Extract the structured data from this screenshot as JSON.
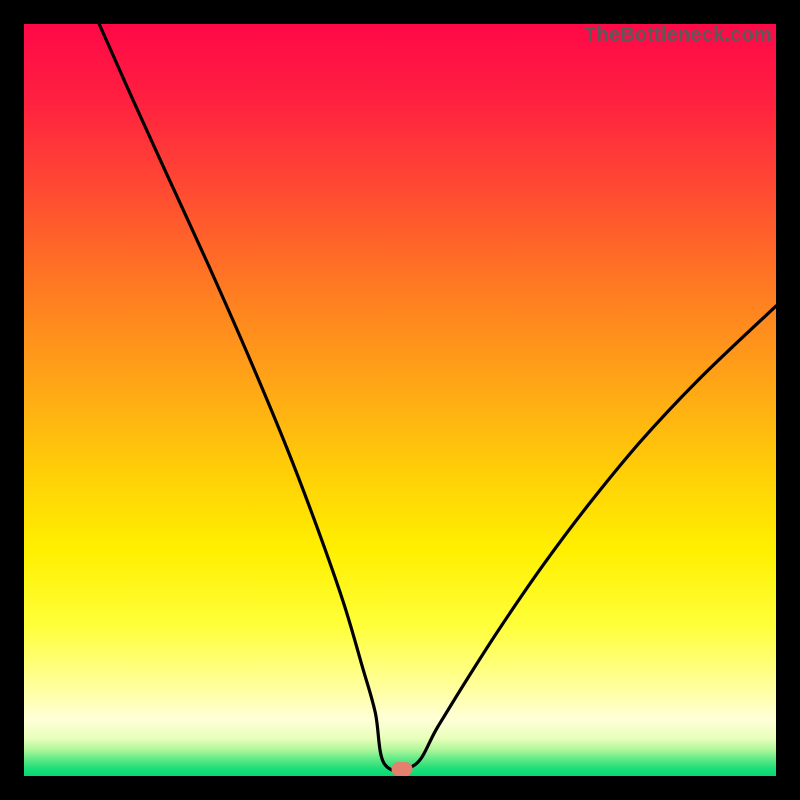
{
  "watermark": {
    "text": "TheBottleneck.com"
  },
  "colors": {
    "marker": "#e4816e",
    "curve": "#000000",
    "gradient_stops": [
      {
        "offset": 0.0,
        "color": "#ff0847"
      },
      {
        "offset": 0.1,
        "color": "#ff2040"
      },
      {
        "offset": 0.22,
        "color": "#ff4a32"
      },
      {
        "offset": 0.35,
        "color": "#ff7a22"
      },
      {
        "offset": 0.48,
        "color": "#ffa616"
      },
      {
        "offset": 0.6,
        "color": "#ffd007"
      },
      {
        "offset": 0.7,
        "color": "#fff000"
      },
      {
        "offset": 0.8,
        "color": "#ffff3a"
      },
      {
        "offset": 0.88,
        "color": "#ffff9a"
      },
      {
        "offset": 0.925,
        "color": "#ffffd8"
      },
      {
        "offset": 0.95,
        "color": "#e8ffba"
      },
      {
        "offset": 0.965,
        "color": "#aff79b"
      },
      {
        "offset": 0.978,
        "color": "#5de985"
      },
      {
        "offset": 0.99,
        "color": "#1ede79"
      },
      {
        "offset": 1.0,
        "color": "#06d872"
      }
    ]
  },
  "chart_data": {
    "type": "line",
    "title": "",
    "xlabel": "",
    "ylabel": "",
    "xlim": [
      0,
      100
    ],
    "ylim": [
      0,
      100
    ],
    "legend": false,
    "grid": false,
    "marker": {
      "x": 50.2,
      "y": 0.9
    },
    "series": [
      {
        "name": "left-branch",
        "x": [
          10.0,
          14.0,
          19.0,
          24.5,
          30.0,
          35.0,
          39.0,
          42.5,
          45.0,
          46.7,
          48.0
        ],
        "y": [
          100.0,
          91.0,
          80.0,
          68.0,
          55.5,
          43.5,
          33.0,
          23.0,
          14.5,
          8.5,
          1.5
        ]
      },
      {
        "name": "flat",
        "x": [
          48.0,
          52.0
        ],
        "y": [
          1.5,
          1.5
        ]
      },
      {
        "name": "right-branch",
        "x": [
          52.0,
          55.0,
          59.0,
          63.5,
          69.0,
          75.0,
          82.0,
          90.0,
          100.0
        ],
        "y": [
          1.5,
          6.5,
          13.0,
          20.0,
          28.0,
          36.0,
          44.5,
          53.0,
          62.5
        ]
      }
    ]
  }
}
